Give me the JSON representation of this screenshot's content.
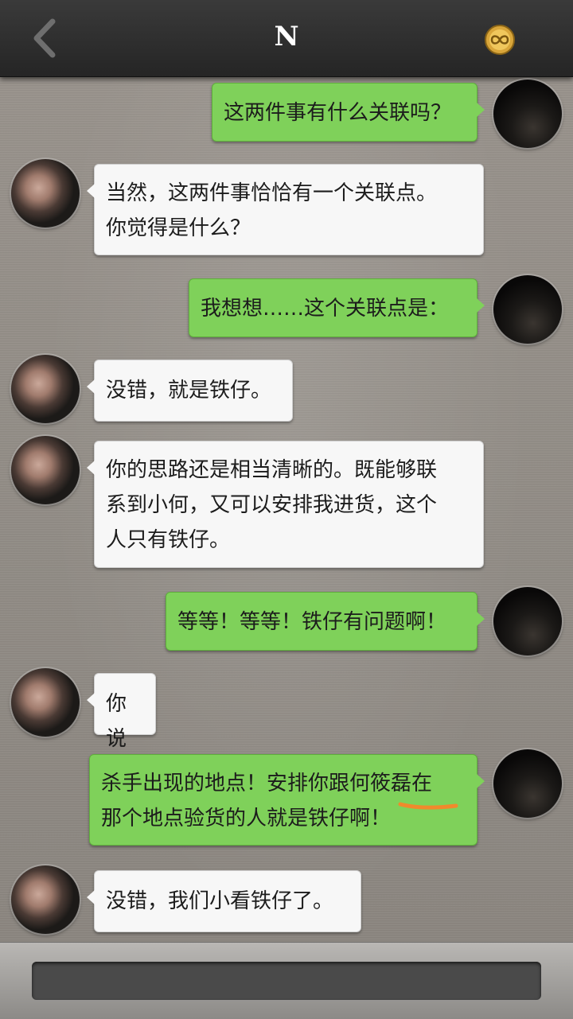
{
  "header": {
    "back_icon": "chevron-left-icon",
    "title": "N",
    "badge_icon": "infinity-coin-icon"
  },
  "messages": [
    {
      "side": "right",
      "lines": [
        "这两件事有什么关联吗？"
      ]
    },
    {
      "side": "left",
      "lines": [
        "当然，这两件事恰恰有一个关联点。",
        "你觉得是什么？"
      ]
    },
    {
      "side": "right",
      "lines": [
        "我想想……这个关联点是："
      ]
    },
    {
      "side": "left",
      "lines": [
        "没错，就是铁仔。"
      ]
    },
    {
      "side": "left",
      "lines": [
        "你的思路还是相当清晰的。既能够联",
        "系到小何，又可以安排我进货，这个",
        "人只有铁仔。"
      ]
    },
    {
      "side": "right",
      "lines": [
        "等等！等等！铁仔有问题啊！"
      ]
    },
    {
      "side": "left",
      "lines": [
        "你说"
      ]
    },
    {
      "side": "right",
      "lines": [
        "杀手出现的地点！安排你跟何筱磊在",
        "那个地点验货的人就是铁仔啊！"
      ]
    },
    {
      "side": "left",
      "lines": [
        "没错，我们小看铁仔了。"
      ]
    }
  ],
  "colors": {
    "outgoing_bubble": "#7fd15a",
    "incoming_bubble": "#f7f7f7",
    "annotation_underline": "#f08a2c"
  },
  "input": {
    "value": "",
    "placeholder": ""
  }
}
